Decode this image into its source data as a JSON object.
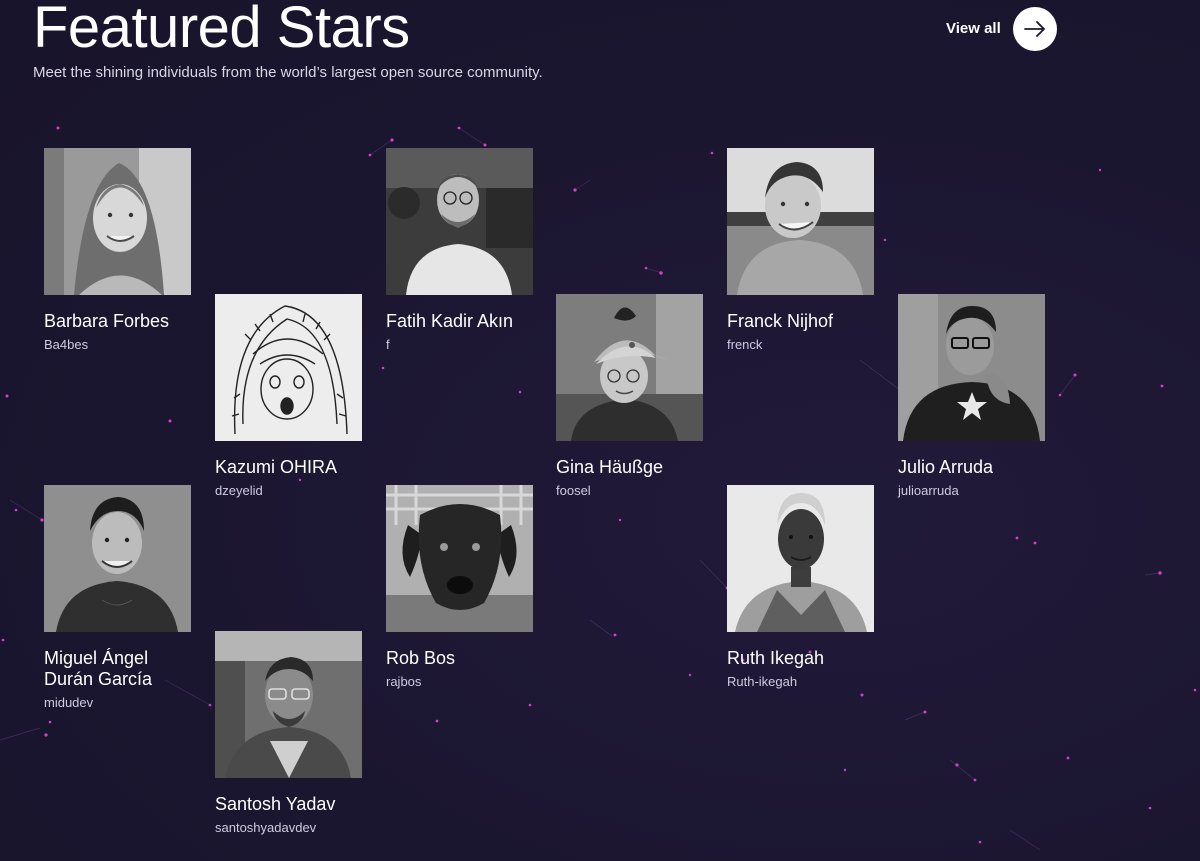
{
  "header": {
    "title": "Featured Stars",
    "subtitle": "Meet the shining individuals from the world’s largest open source community.",
    "view_all_label": "View all"
  },
  "stars": [
    {
      "name": "Barbara Forbes",
      "handle": "Ba4bes"
    },
    {
      "name": "Kazumi OHIRA",
      "handle": "dzeyelid"
    },
    {
      "name": "Fatih Kadir Akın",
      "handle": "f"
    },
    {
      "name": "Gina Häußge",
      "handle": "foosel"
    },
    {
      "name": "Franck Nijhof",
      "handle": "frenck"
    },
    {
      "name": "Julio Arruda",
      "handle": "julioarruda"
    },
    {
      "name": "Miguel Ángel Durán García",
      "handle": "midudev"
    },
    {
      "name": "Santosh Yadav",
      "handle": "santoshyadavdev"
    },
    {
      "name": "Rob Bos",
      "handle": "rajbos"
    },
    {
      "name": "Ruth Ikegah",
      "handle": "Ruth-ikegah"
    }
  ],
  "colors": {
    "background": "#1c1731",
    "star_dot": "#d63fc7",
    "text": "#ffffff",
    "muted_text": "#cfcbe0"
  },
  "icons": {
    "view_all": "arrow-right-icon"
  }
}
